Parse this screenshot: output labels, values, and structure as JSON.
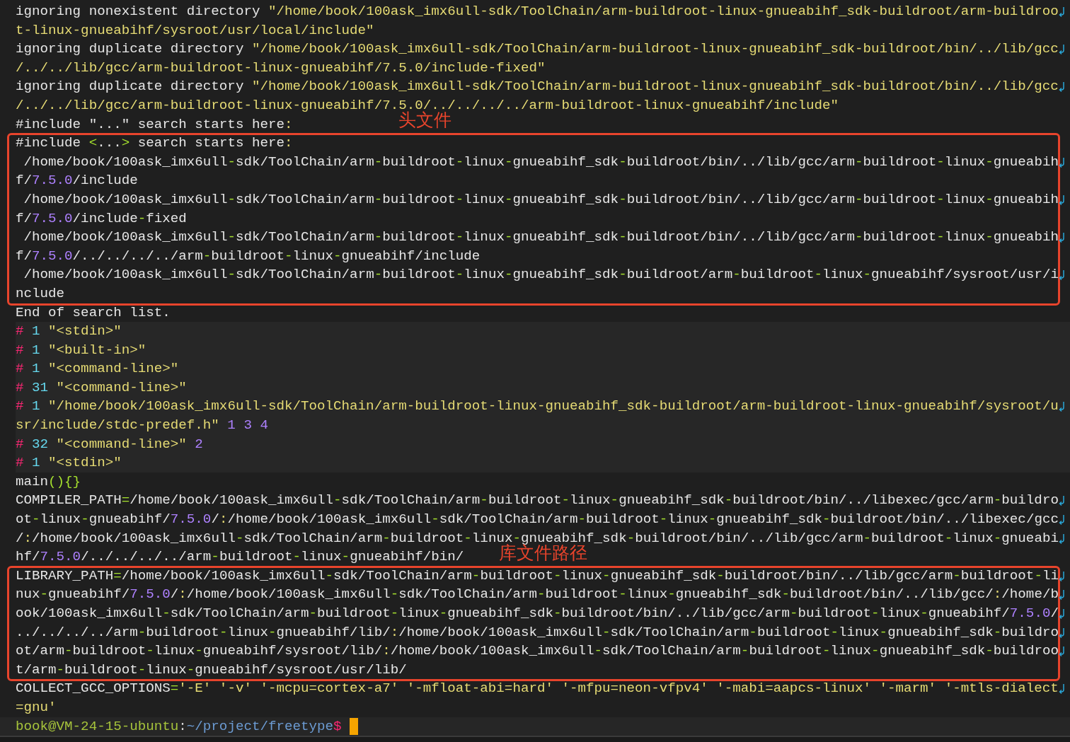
{
  "terminal": {
    "blocks": [
      {
        "kind": "plain",
        "lines": [
          {
            "wrapped": true,
            "segments": [
              {
                "text": "ignoring nonexistent directory ",
                "kind": "text"
              },
              {
                "text": "\"/home/book/100ask_imx6ull-sdk/ToolChain/arm-buildroot-linux-gnueabihf_sdk-buildroot/arm-buildroo",
                "kind": "string"
              }
            ]
          },
          {
            "wrapped": false,
            "segments": [
              {
                "text": "t-linux-gnueabihf/sysroot/usr/local/include\"",
                "kind": "string"
              }
            ]
          },
          {
            "wrapped": true,
            "segments": [
              {
                "text": "ignoring duplicate directory ",
                "kind": "text"
              },
              {
                "text": "\"/home/book/100ask_imx6ull-sdk/ToolChain/arm-buildroot-linux-gnueabihf_sdk-buildroot/bin/../lib/gcc",
                "kind": "string"
              }
            ]
          },
          {
            "wrapped": false,
            "segments": [
              {
                "text": "/../../lib/gcc/arm-buildroot-linux-gnueabihf/7.5.0/include-fixed\"",
                "kind": "string"
              }
            ]
          },
          {
            "wrapped": true,
            "segments": [
              {
                "text": "ignoring duplicate directory ",
                "kind": "text"
              },
              {
                "text": "\"/home/book/100ask_imx6ull-sdk/ToolChain/arm-buildroot-linux-gnueabihf_sdk-buildroot/bin/../lib/gcc",
                "kind": "string"
              }
            ]
          },
          {
            "wrapped": false,
            "segments": [
              {
                "text": "/../../lib/gcc/arm-buildroot-linux-gnueabihf/7.5.0/../../../../arm-buildroot-linux-gnueabihf/include\"",
                "kind": "string"
              }
            ]
          },
          {
            "wrapped": false,
            "segments": [
              {
                "text": "#include \"...\" search starts here:",
                "kind": "text"
              }
            ]
          }
        ]
      },
      {
        "kind": "frame",
        "annotation": "头文件",
        "lines": [
          {
            "wrapped": false,
            "segments": [
              {
                "text": "#include <...> search starts here:",
                "kind": "text"
              }
            ]
          },
          {
            "wrapped": true,
            "segments": [
              {
                "text": " /home/book/100ask_imx6ull-sdk/ToolChain/arm-buildroot-linux-gnueabihf_sdk-buildroot/bin/../lib/gcc/arm-buildroot-linux-gnueabih",
                "kind": "text"
              }
            ]
          },
          {
            "wrapped": false,
            "segments": [
              {
                "text": "f/7.5.0/include",
                "kind": "text"
              }
            ]
          },
          {
            "wrapped": true,
            "segments": [
              {
                "text": " /home/book/100ask_imx6ull-sdk/ToolChain/arm-buildroot-linux-gnueabihf_sdk-buildroot/bin/../lib/gcc/arm-buildroot-linux-gnueabih",
                "kind": "text"
              }
            ]
          },
          {
            "wrapped": false,
            "segments": [
              {
                "text": "f/7.5.0/include-fixed",
                "kind": "text"
              }
            ]
          },
          {
            "wrapped": true,
            "segments": [
              {
                "text": " /home/book/100ask_imx6ull-sdk/ToolChain/arm-buildroot-linux-gnueabihf_sdk-buildroot/bin/../lib/gcc/arm-buildroot-linux-gnueabih",
                "kind": "text"
              }
            ]
          },
          {
            "wrapped": false,
            "segments": [
              {
                "text": "f/7.5.0/../../../../arm-buildroot-linux-gnueabihf/include",
                "kind": "text"
              }
            ]
          },
          {
            "wrapped": true,
            "segments": [
              {
                "text": " /home/book/100ask_imx6ull-sdk/ToolChain/arm-buildroot-linux-gnueabihf_sdk-buildroot/arm-buildroot-linux-gnueabihf/sysroot/usr/i",
                "kind": "text"
              }
            ]
          },
          {
            "wrapped": false,
            "segments": [
              {
                "text": "nclude",
                "kind": "text"
              }
            ]
          }
        ]
      },
      {
        "kind": "plain",
        "lines": [
          {
            "wrapped": false,
            "segments": [
              {
                "text": "End of search list.",
                "kind": "text"
              }
            ]
          }
        ]
      },
      {
        "kind": "band",
        "lines": [
          {
            "wrapped": false,
            "segments": [
              {
                "text": "#",
                "kind": "hash"
              },
              {
                "text": " 1",
                "kind": "lineno"
              },
              {
                "text": " \"<stdin>\"",
                "kind": "string"
              }
            ]
          },
          {
            "wrapped": false,
            "segments": [
              {
                "text": "#",
                "kind": "hash"
              },
              {
                "text": " 1",
                "kind": "lineno"
              },
              {
                "text": " \"<built-in>\"",
                "kind": "string"
              }
            ]
          },
          {
            "wrapped": false,
            "segments": [
              {
                "text": "#",
                "kind": "hash"
              },
              {
                "text": " 1",
                "kind": "lineno"
              },
              {
                "text": " \"<command-line>\"",
                "kind": "string"
              }
            ]
          },
          {
            "wrapped": false,
            "segments": [
              {
                "text": "#",
                "kind": "hash"
              },
              {
                "text": " 31",
                "kind": "lineno"
              },
              {
                "text": " \"<command-line>\"",
                "kind": "string"
              }
            ]
          },
          {
            "wrapped": true,
            "segments": [
              {
                "text": "#",
                "kind": "hash"
              },
              {
                "text": " 1",
                "kind": "lineno"
              },
              {
                "text": " \"/home/book/100ask_imx6ull-sdk/ToolChain/arm-buildroot-linux-gnueabihf_sdk-buildroot/arm-buildroot-linux-gnueabihf/sysroot/u",
                "kind": "string"
              }
            ]
          },
          {
            "wrapped": false,
            "segments": [
              {
                "text": "sr/include/stdc-predef.h\"",
                "kind": "string"
              },
              {
                "text": " 1 3 4",
                "kind": "number"
              }
            ]
          },
          {
            "wrapped": false,
            "segments": [
              {
                "text": "#",
                "kind": "hash"
              },
              {
                "text": " 32",
                "kind": "lineno"
              },
              {
                "text": " \"<command-line>\"",
                "kind": "string"
              },
              {
                "text": " 2",
                "kind": "number"
              }
            ]
          },
          {
            "wrapped": false,
            "segments": [
              {
                "text": "#",
                "kind": "hash"
              },
              {
                "text": " 1",
                "kind": "lineno"
              },
              {
                "text": " \"<stdin>\"",
                "kind": "string"
              }
            ]
          }
        ]
      },
      {
        "kind": "plain",
        "lines": [
          {
            "wrapped": false,
            "segments": [
              {
                "text": "main(){}",
                "kind": "text"
              }
            ]
          },
          {
            "wrapped": true,
            "segments": [
              {
                "text": "COMPILER_PATH=/home/book/100ask_imx6ull-sdk/ToolChain/arm-buildroot-linux-gnueabihf_sdk-buildroot/bin/../libexec/gcc/arm-buildro",
                "kind": "text"
              }
            ]
          },
          {
            "wrapped": true,
            "segments": [
              {
                "text": "ot-linux-gnueabihf/7.5.0/:/home/book/100ask_imx6ull-sdk/ToolChain/arm-buildroot-linux-gnueabihf_sdk-buildroot/bin/../libexec/gcc",
                "kind": "text"
              }
            ]
          },
          {
            "wrapped": true,
            "segments": [
              {
                "text": "/:/home/book/100ask_imx6ull-sdk/ToolChain/arm-buildroot-linux-gnueabihf_sdk-buildroot/bin/../lib/gcc/arm-buildroot-linux-gnueabi",
                "kind": "text"
              }
            ]
          },
          {
            "wrapped": false,
            "segments": [
              {
                "text": "hf/7.5.0/../../../../arm-buildroot-linux-gnueabihf/bin/",
                "kind": "text"
              }
            ]
          }
        ]
      },
      {
        "kind": "frame",
        "annotation": "库文件路径",
        "lines": [
          {
            "wrapped": true,
            "segments": [
              {
                "text": "LIBRARY_PATH=/home/book/100ask_imx6ull-sdk/ToolChain/arm-buildroot-linux-gnueabihf_sdk-buildroot/bin/../lib/gcc/arm-buildroot-li",
                "kind": "text"
              }
            ]
          },
          {
            "wrapped": true,
            "segments": [
              {
                "text": "nux-gnueabihf/7.5.0/:/home/book/100ask_imx6ull-sdk/ToolChain/arm-buildroot-linux-gnueabihf_sdk-buildroot/bin/../lib/gcc/:/home/b",
                "kind": "text"
              }
            ]
          },
          {
            "wrapped": true,
            "segments": [
              {
                "text": "ook/100ask_imx6ull-sdk/ToolChain/arm-buildroot-linux-gnueabihf_sdk-buildroot/bin/../lib/gcc/arm-buildroot-linux-gnueabihf/7.5.0/",
                "kind": "text"
              }
            ]
          },
          {
            "wrapped": true,
            "segments": [
              {
                "text": "../../../../arm-buildroot-linux-gnueabihf/lib/:/home/book/100ask_imx6ull-sdk/ToolChain/arm-buildroot-linux-gnueabihf_sdk-buildro",
                "kind": "text"
              }
            ]
          },
          {
            "wrapped": true,
            "segments": [
              {
                "text": "ot/arm-buildroot-linux-gnueabihf/sysroot/lib/:/home/book/100ask_imx6ull-sdk/ToolChain/arm-buildroot-linux-gnueabihf_sdk-buildroo",
                "kind": "text"
              }
            ]
          },
          {
            "wrapped": false,
            "segments": [
              {
                "text": "t/arm-buildroot-linux-gnueabihf/sysroot/usr/lib/",
                "kind": "text"
              }
            ]
          }
        ]
      },
      {
        "kind": "plain",
        "lines": [
          {
            "wrapped": true,
            "segments": [
              {
                "text": "COLLECT_GCC_OPTIONS=",
                "kind": "text"
              },
              {
                "text": "'-E' '-v' '-mcpu=cortex-a7' '-mfloat-abi=hard' '-mfpu=neon-vfpv4' '-mabi=aapcs-linux' '-marm' '-mtls-dialect",
                "kind": "string"
              }
            ]
          },
          {
            "wrapped": false,
            "segments": [
              {
                "text": "=gnu'",
                "kind": "string"
              }
            ]
          }
        ]
      },
      {
        "kind": "prompt",
        "lines": [
          {
            "wrapped": false,
            "segments": [
              {
                "text": "book@VM-24-15-ubuntu",
                "kind": "user"
              },
              {
                "text": ":",
                "kind": "plain"
              },
              {
                "text": "~/project/freetype",
                "kind": "path"
              },
              {
                "text": "$",
                "kind": "hash"
              }
            ]
          }
        ]
      }
    ]
  }
}
